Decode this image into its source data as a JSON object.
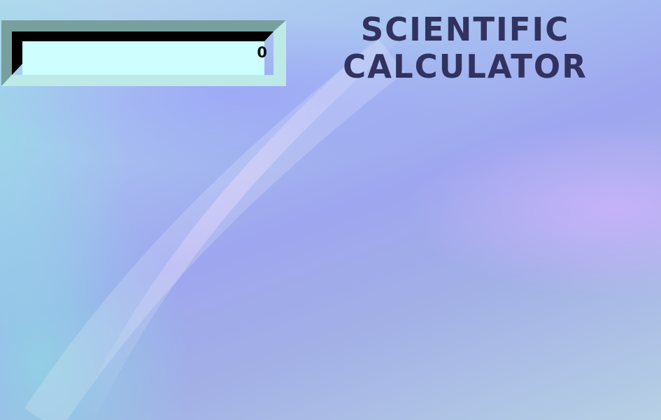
{
  "title": {
    "line1": "SCIENTIFIC",
    "line2": "CALCULATOR"
  },
  "display": {
    "value": "0"
  },
  "colors": {
    "title": "#31325f",
    "display_background": "#ccfffd",
    "frame_dark": "#000000",
    "frame_shadow": "#779f9d",
    "frame_light": "#bde9e6"
  }
}
